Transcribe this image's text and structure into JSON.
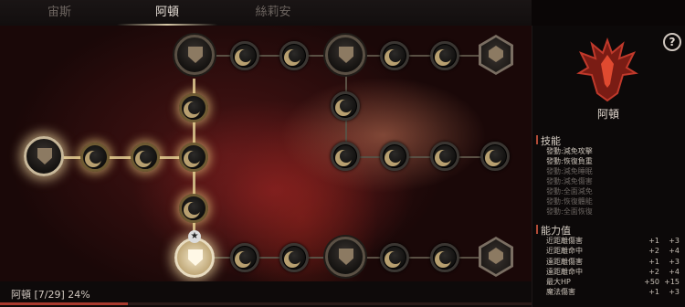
{
  "tabs": [
    {
      "label": "宙斯",
      "active": false
    },
    {
      "label": "阿頓",
      "active": true
    },
    {
      "label": "絲莉安",
      "active": false
    }
  ],
  "hero": {
    "name": "阿頓"
  },
  "progress": {
    "label": "阿頓 [7/29] 24%",
    "percent": 24
  },
  "skills_section": {
    "title": "技能"
  },
  "skills": [
    {
      "label": "發動:減免攻擊",
      "active": true
    },
    {
      "label": "發動:恢復負重",
      "active": true
    },
    {
      "label": "發動:減免睡眠",
      "active": false
    },
    {
      "label": "發動:減免傷害",
      "active": false
    },
    {
      "label": "發動:全面減免",
      "active": false
    },
    {
      "label": "發動:恢復體能",
      "active": false
    },
    {
      "label": "發動:全面恢復",
      "active": false
    }
  ],
  "stats_section": {
    "title": "能力值"
  },
  "stats": [
    {
      "name": "近距離傷害",
      "current": "+1",
      "max": "+3"
    },
    {
      "name": "近距離命中",
      "current": "+2",
      "max": "+4"
    },
    {
      "name": "遠距離傷害",
      "current": "+1",
      "max": "+3"
    },
    {
      "name": "遠距離命中",
      "current": "+2",
      "max": "+4"
    },
    {
      "name": "最大HP",
      "current": "+50",
      "max": "+15"
    },
    {
      "name": "魔法傷害",
      "current": "+1",
      "max": "+3"
    }
  ],
  "help_label": "?",
  "colors": {
    "accent": "#b04a36",
    "gold": "#c8b080",
    "bar": "#a83a2e"
  }
}
